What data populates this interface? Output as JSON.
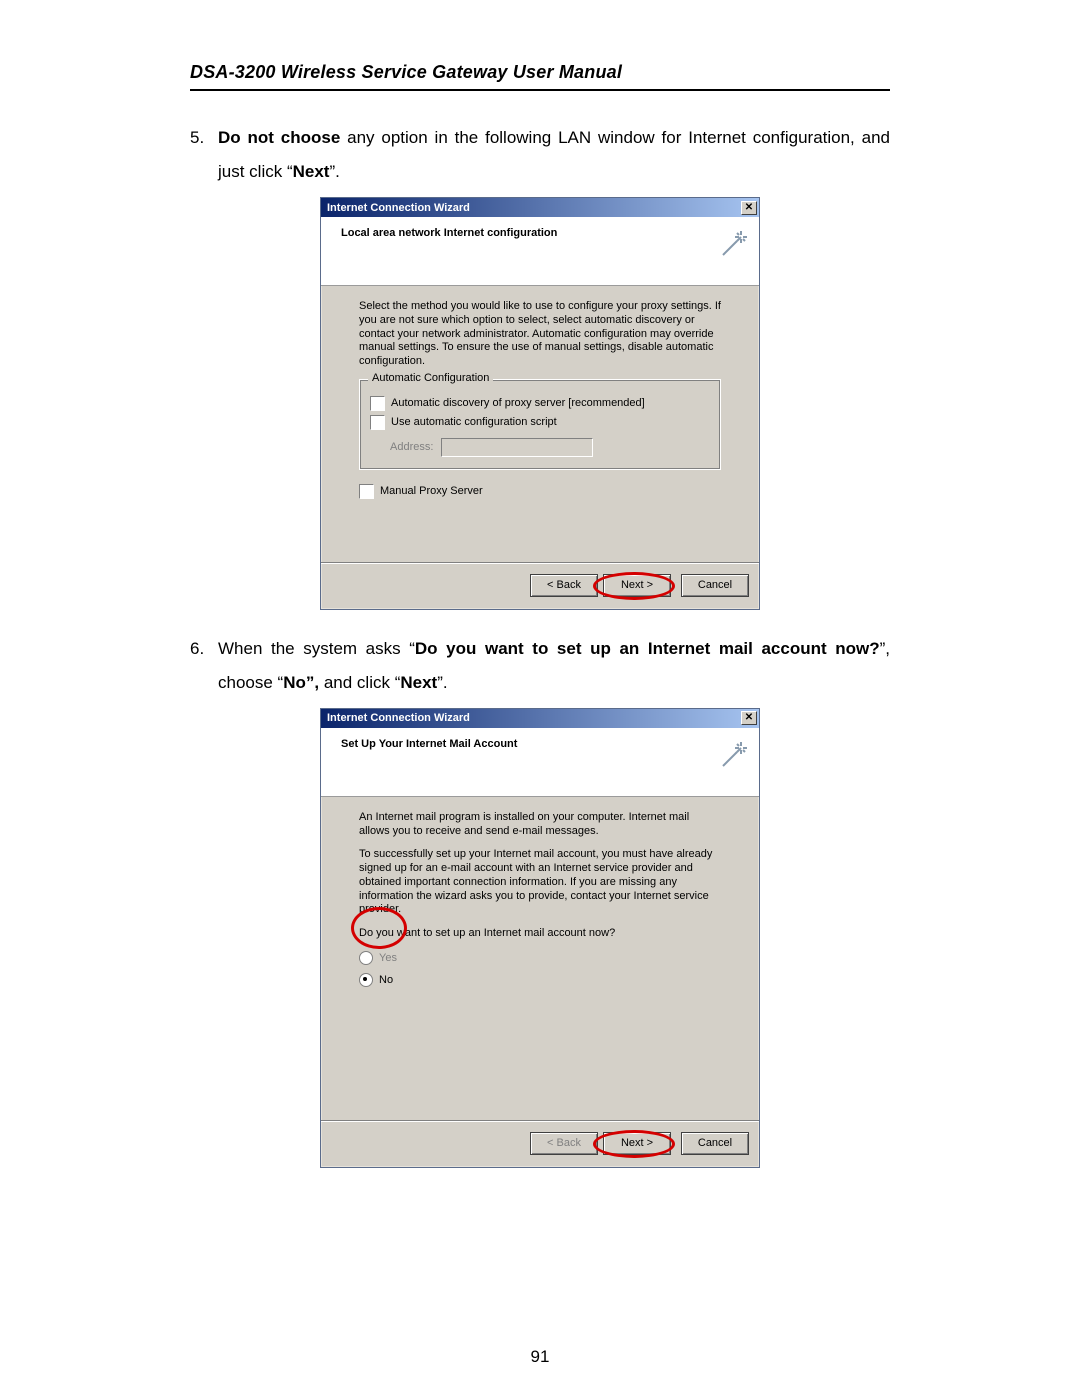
{
  "header": {
    "title": "DSA-3200 Wireless Service Gateway User Manual"
  },
  "step5": {
    "num": "5.",
    "lead_strong": "Do not choose",
    "lead_rest": " any option in the following LAN window for Internet configuration, and just click “",
    "next_word": "Next",
    "tail": "”."
  },
  "step6": {
    "num": "6.",
    "t1": "When the system asks “",
    "q1": "Do you want to set up an Internet mail account now?",
    "t2": "”, choose “",
    "q2": "No",
    "t3": "”,",
    "t4": " and click “",
    "q3": "Next",
    "t5": "”."
  },
  "wizard1": {
    "title": "Internet Connection Wizard",
    "close": "✕",
    "head_title": "Local area network Internet configuration",
    "intro": "Select the method you would like to use to configure your proxy settings.  If you are not sure which option to select, select automatic discovery or contact your network administrator.  Automatic configuration may override manual settings.  To ensure the use of manual settings, disable automatic configuration.",
    "group_legend": "Automatic Configuration",
    "chk1": "Automatic discovery of proxy server [recommended]",
    "chk2": "Use automatic configuration script",
    "addr_label": "Address:",
    "manual_proxy": "Manual Proxy Server",
    "back": "< Back",
    "next": "Next >",
    "cancel": "Cancel"
  },
  "wizard2": {
    "title": "Internet Connection Wizard",
    "close": "✕",
    "head_title": "Set Up Your Internet Mail Account",
    "p1": "An Internet mail program is installed on your computer. Internet mail allows you to receive and send e-mail messages.",
    "p2": "To successfully set up your Internet mail account, you must have already signed up for an e-mail account with an Internet service provider and obtained important connection information. If you are missing any information the wizard asks you to provide, contact your Internet service provider.",
    "question": "Do you want to set up an Internet mail account now?",
    "yes": "Yes",
    "no": "No",
    "back": "< Back",
    "next": "Next >",
    "cancel": "Cancel"
  },
  "page_number": "91"
}
